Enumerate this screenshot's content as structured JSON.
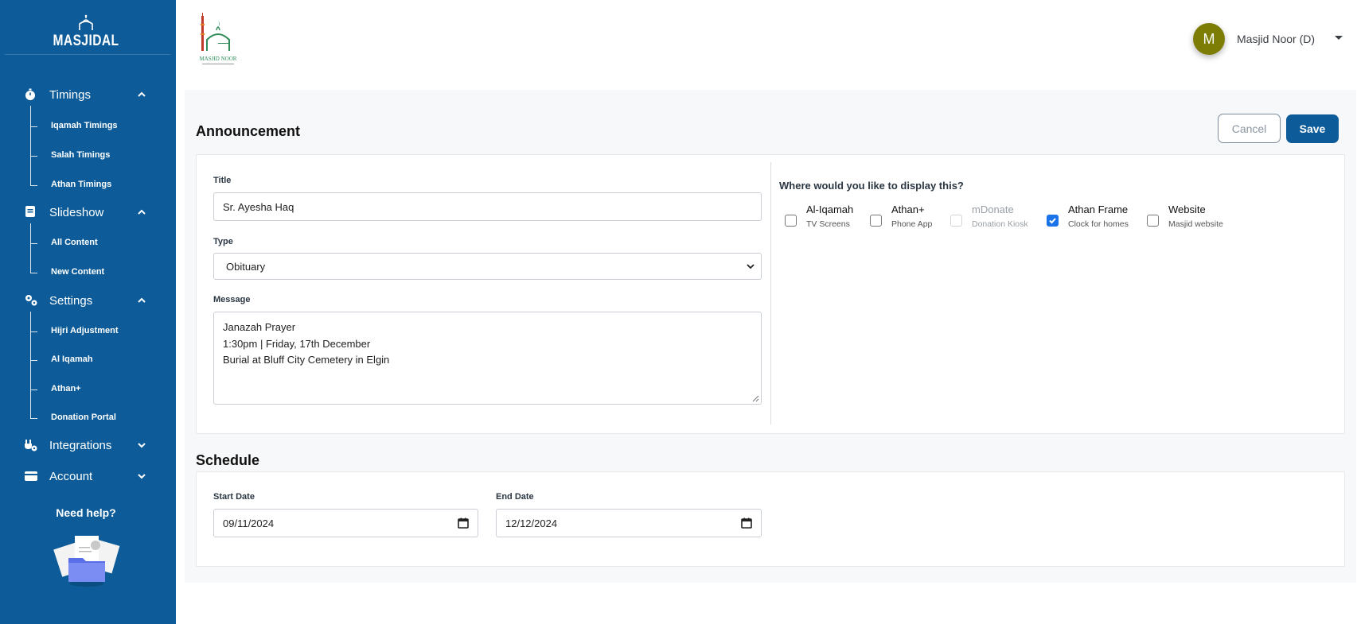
{
  "brand": {
    "name": "MASJIDAL"
  },
  "sidebar": {
    "sections": [
      {
        "label": "Timings",
        "icon": "stopwatch-icon",
        "expanded": true,
        "items": [
          {
            "label": "Iqamah Timings"
          },
          {
            "label": "Salah Timings"
          },
          {
            "label": "Athan Timings"
          }
        ]
      },
      {
        "label": "Slideshow",
        "icon": "slides-icon",
        "expanded": true,
        "items": [
          {
            "label": "All Content"
          },
          {
            "label": "New Content"
          }
        ]
      },
      {
        "label": "Settings",
        "icon": "gears-icon",
        "expanded": true,
        "items": [
          {
            "label": "Hijri Adjustment"
          },
          {
            "label": "Al Iqamah"
          },
          {
            "label": "Athan+"
          },
          {
            "label": "Donation Portal"
          }
        ]
      },
      {
        "label": "Integrations",
        "icon": "plug-icon",
        "expanded": false,
        "items": []
      },
      {
        "label": "Account",
        "icon": "card-icon",
        "expanded": false,
        "items": []
      }
    ],
    "help": "Need help?"
  },
  "header": {
    "user_initial": "M",
    "user_name": "Masjid Noor (D)"
  },
  "announcement": {
    "heading": "Announcement",
    "cancel_label": "Cancel",
    "save_label": "Save",
    "title_label": "Title",
    "title_value": "Sr. Ayesha Haq",
    "type_label": "Type",
    "type_value": "Obituary",
    "message_label": "Message",
    "message_lines": [
      "Janazah Prayer",
      "1:30pm | Friday, 17th December",
      "Burial at Bluff City Cemetery in Elgin"
    ],
    "display_question": "Where would you like to display this?",
    "display_options": [
      {
        "name": "Al-Iqamah",
        "sub": "TV Screens",
        "checked": false,
        "disabled": false
      },
      {
        "name": "Athan+",
        "sub": "Phone App",
        "checked": false,
        "disabled": false
      },
      {
        "name": "mDonate",
        "sub": "Donation Kiosk",
        "checked": false,
        "disabled": true
      },
      {
        "name": "Athan Frame",
        "sub": "Clock for homes",
        "checked": true,
        "disabled": false
      },
      {
        "name": "Website",
        "sub": "Masjid website",
        "checked": false,
        "disabled": false
      }
    ]
  },
  "schedule": {
    "heading": "Schedule",
    "start_label": "Start Date",
    "start_value": "09/11/2024",
    "end_label": "End Date",
    "end_value": "12/12/2024"
  },
  "colors": {
    "sidebar": "#0d5c99",
    "accent": "#0d5c99",
    "checkbox": "#1a73e8",
    "avatar": "#7d7d06"
  }
}
